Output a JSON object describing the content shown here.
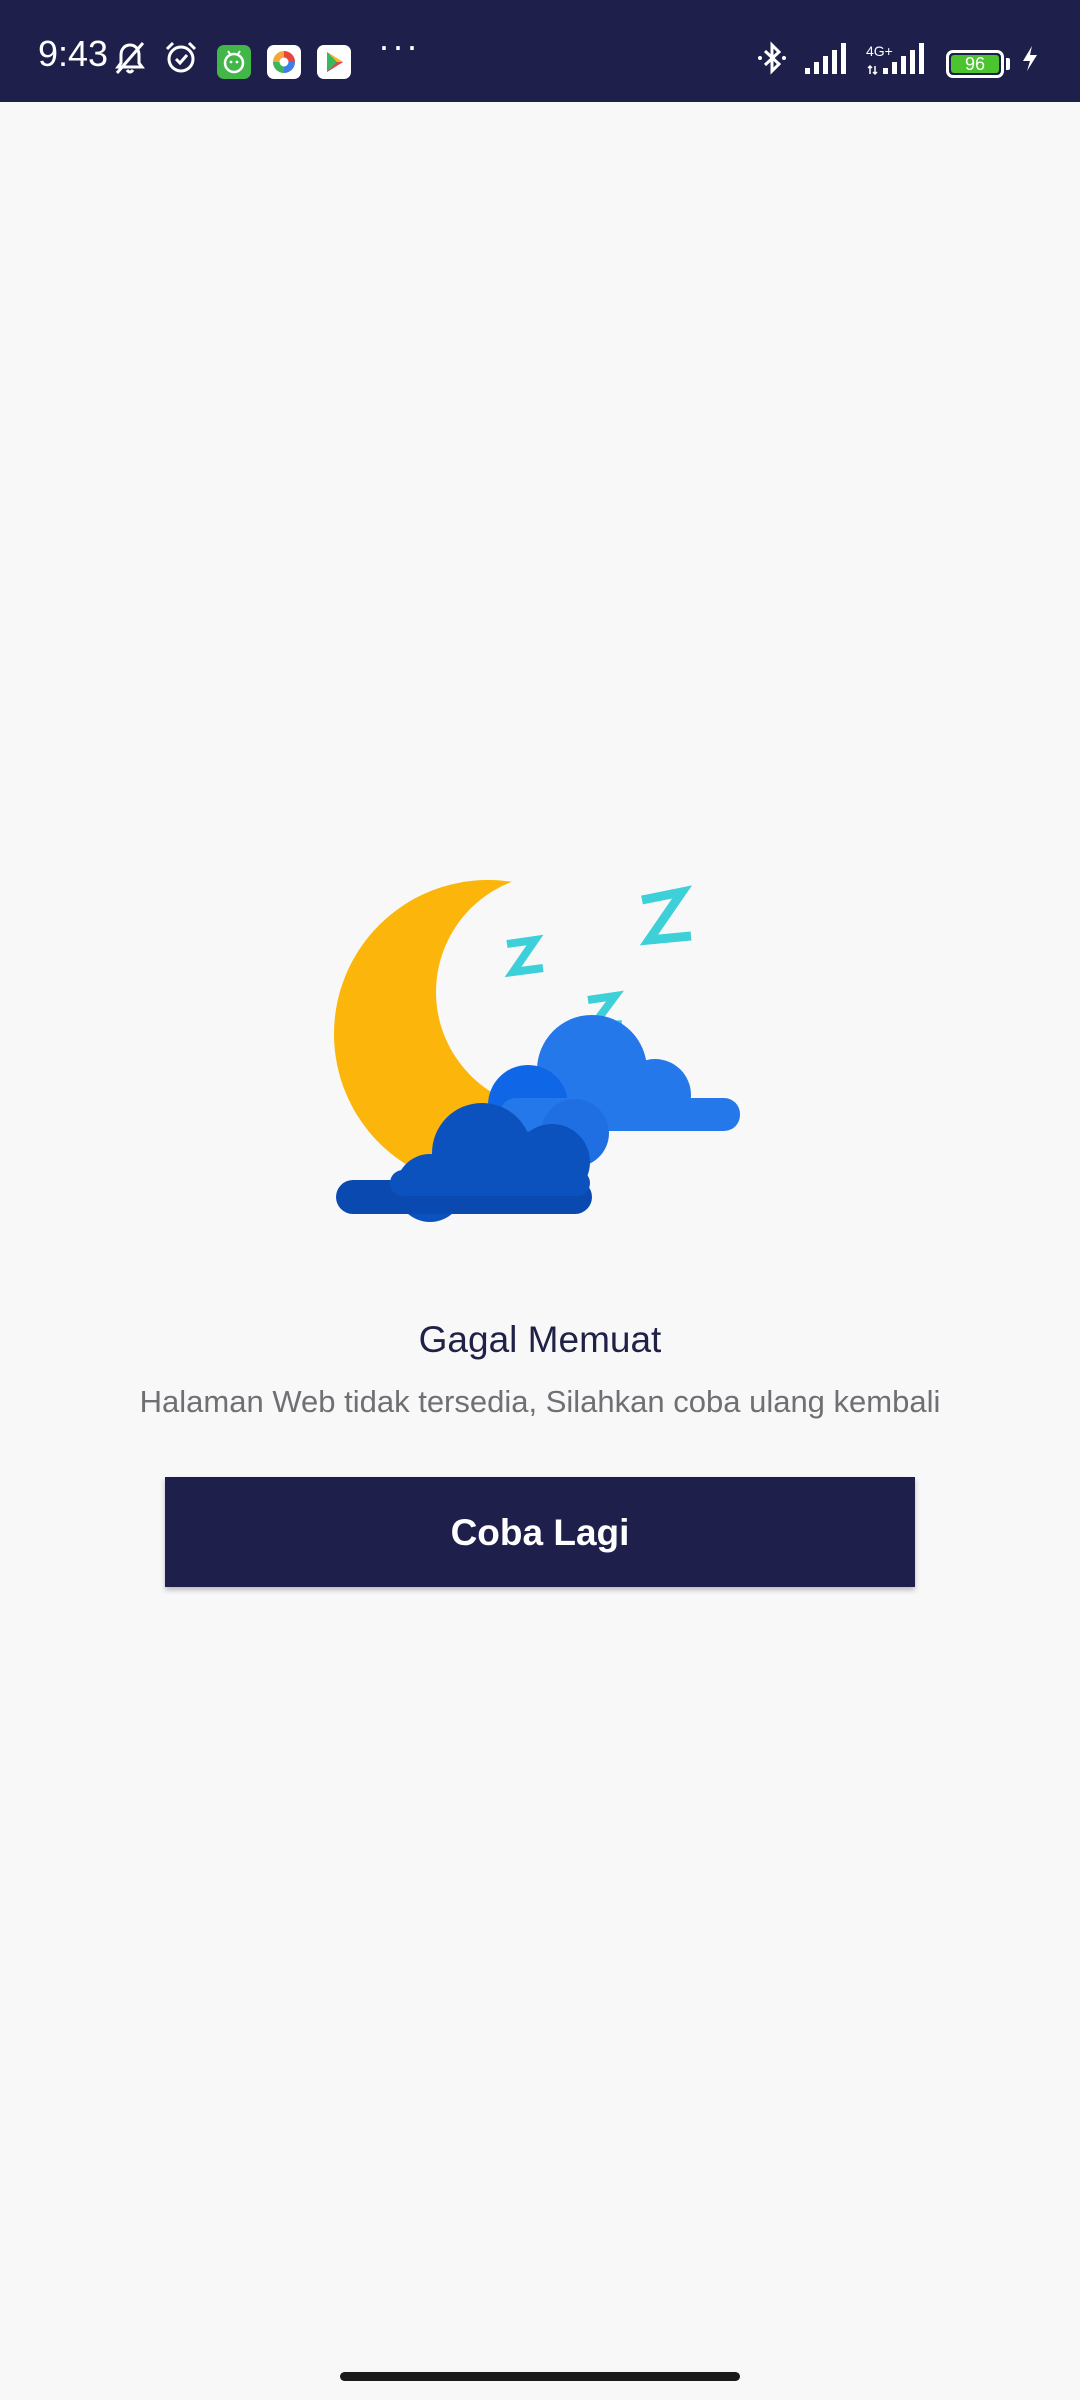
{
  "status_bar": {
    "time": "9:43",
    "network_label": "4G+",
    "battery_level": "96",
    "background_color": "#1e1f4b",
    "icons": [
      "bell-off-icon",
      "alarm-icon",
      "android-app-icon",
      "photos-app-icon",
      "play-store-icon",
      "more-dots-icon",
      "bluetooth-icon",
      "signal-icon",
      "signal-4g-icon",
      "battery-icon",
      "charging-icon"
    ]
  },
  "error": {
    "title": "Gagal Memuat",
    "message": "Halaman Web tidak tersedia, Silahkan coba ulang kembali",
    "illustration_icon": "sleeping-moon-cloud-icon"
  },
  "actions": {
    "retry_label": "Coba Lagi",
    "button_color": "#1f1f4b"
  },
  "colors": {
    "moon": "#fbb50b",
    "zzz": "#3ed0d9",
    "cloud_back": "#2578ea",
    "cloud_front": "#0b52be",
    "page_background": "#f8f8f9"
  }
}
